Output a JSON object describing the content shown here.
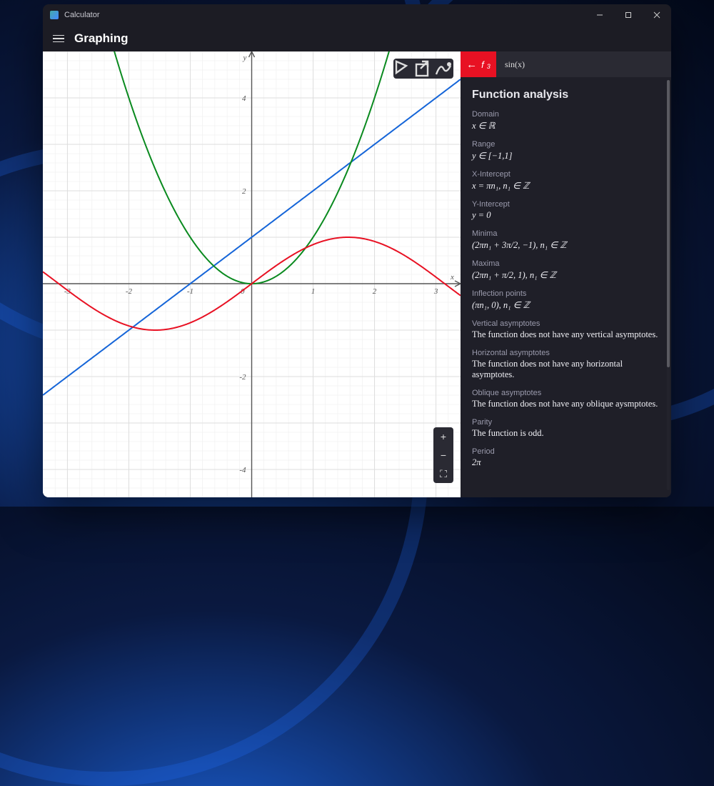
{
  "app": {
    "title": "Calculator",
    "mode": "Graphing"
  },
  "toolbar": {
    "trace": "trace",
    "share": "share",
    "options": "options",
    "zoom_in": "+",
    "zoom_out": "−",
    "fit": "⛶"
  },
  "function_bar": {
    "back_symbol": "f",
    "back_subscript": "3",
    "expression": "sin(x)"
  },
  "analysis": {
    "heading": "Function analysis",
    "props": [
      {
        "label": "Domain",
        "value": "x ∈ ℝ",
        "serif": true
      },
      {
        "label": "Range",
        "value": "y ∈ [−1,1]",
        "serif": true
      },
      {
        "label": "X-Intercept",
        "value": "x = πn₁, n₁ ∈ ℤ",
        "serif": true
      },
      {
        "label": "Y-Intercept",
        "value": "y = 0",
        "serif": true
      },
      {
        "label": "Minima",
        "value": "(2πn₁ + 3π/2, −1), n₁ ∈ ℤ",
        "serif": true
      },
      {
        "label": "Maxima",
        "value": "(2πn₁ + π/2, 1), n₁ ∈ ℤ",
        "serif": true
      },
      {
        "label": "Inflection points",
        "value": "(πn₁, 0), n₁ ∈ ℤ",
        "serif": true
      },
      {
        "label": "Vertical asymptotes",
        "value": "The function does not have any vertical asymptotes.",
        "serif": false
      },
      {
        "label": "Horizontal asymptotes",
        "value": "The function does not have any horizontal asymptotes.",
        "serif": false
      },
      {
        "label": "Oblique asymptotes",
        "value": "The function does not have any oblique aysmptotes.",
        "serif": false
      },
      {
        "label": "Parity",
        "value": "The function is odd.",
        "serif": false
      },
      {
        "label": "Period",
        "value": "2π",
        "serif": true
      }
    ]
  },
  "chart_data": {
    "type": "line",
    "xlim": [
      -3.4,
      3.4
    ],
    "ylim": [
      -4.6,
      5.0
    ],
    "xlabel": "x",
    "ylabel": "y",
    "xticks": [
      -3,
      -2,
      -1,
      1,
      2,
      3
    ],
    "yticks": [
      -4,
      -2,
      2,
      4
    ],
    "series": [
      {
        "name": "line",
        "color": "#1565d8",
        "formula": "y = x + 1"
      },
      {
        "name": "parabola",
        "color": "#0a8a1f",
        "formula": "y = x^2"
      },
      {
        "name": "sin",
        "color": "#e81123",
        "formula": "y = sin(x)"
      }
    ]
  }
}
